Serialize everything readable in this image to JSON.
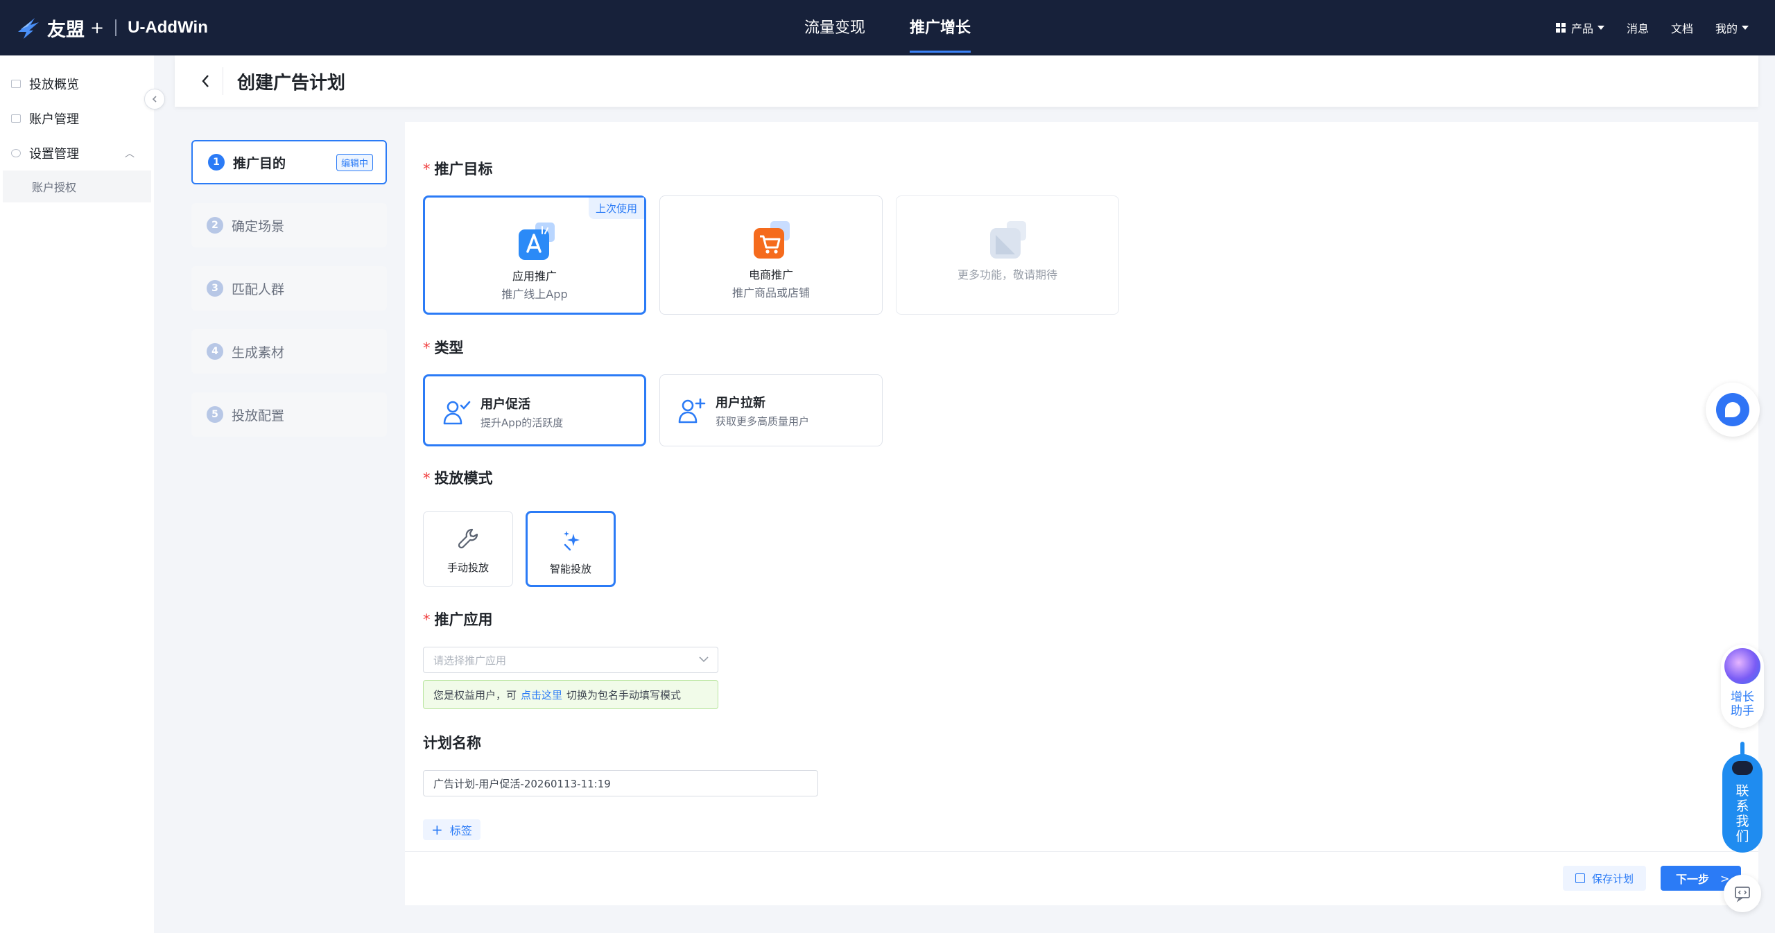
{
  "topbar": {
    "brand": "友盟",
    "brand_plus": "+",
    "product": "U-AddWin",
    "nav": [
      {
        "label": "流量变现",
        "active": false
      },
      {
        "label": "推广增长",
        "active": true
      }
    ],
    "right": {
      "products": "产品",
      "messages": "消息",
      "docs": "文档",
      "mine": "我的"
    }
  },
  "sidebar": {
    "items": [
      {
        "label": "投放概览"
      },
      {
        "label": "账户管理"
      },
      {
        "label": "设置管理",
        "expanded": true
      }
    ],
    "sub_items": [
      {
        "label": "账户授权"
      }
    ]
  },
  "header": {
    "title": "创建广告计划"
  },
  "steps": [
    {
      "num": "1",
      "label": "推广目的",
      "badge": "编辑中",
      "active": true
    },
    {
      "num": "2",
      "label": "确定场景",
      "active": false
    },
    {
      "num": "3",
      "label": "匹配人群",
      "active": false
    },
    {
      "num": "4",
      "label": "生成素材",
      "active": false
    },
    {
      "num": "5",
      "label": "投放配置",
      "active": false
    }
  ],
  "form": {
    "required_mark": "*",
    "target": {
      "label": "推广目标",
      "options": [
        {
          "title": "应用推广",
          "subtitle": "推广线上App",
          "badge": "上次使用",
          "selected": true,
          "icon": "app-store-icon"
        },
        {
          "title": "电商推广",
          "subtitle": "推广商品或店铺",
          "selected": false,
          "icon": "shopping-cart-icon"
        },
        {
          "note": "更多功能，敬请期待",
          "disabled": true,
          "icon": "coming-soon-icon"
        }
      ]
    },
    "type": {
      "label": "类型",
      "options": [
        {
          "title": "用户促活",
          "subtitle": "提升App的活跃度",
          "selected": true,
          "icon": "user-check-icon"
        },
        {
          "title": "用户拉新",
          "subtitle": "获取更多高质量用户",
          "selected": false,
          "icon": "user-add-icon"
        }
      ]
    },
    "mode": {
      "label": "投放模式",
      "options": [
        {
          "title": "手动投放",
          "selected": false,
          "icon": "wrench-icon"
        },
        {
          "title": "智能投放",
          "selected": true,
          "icon": "sparkle-icon"
        }
      ]
    },
    "app": {
      "label": "推广应用",
      "placeholder": "请选择推广应用",
      "tip_before": "您是权益用户，可",
      "tip_link": "点击这里",
      "tip_after": "切换为包名手动填写模式"
    },
    "plan_name": {
      "label": "计划名称",
      "value": "广告计划-用户促活-20260113-11:19"
    },
    "tag_button": "标签",
    "save_button": "保存计划",
    "next_button": "下一步"
  },
  "widgets": {
    "assistant_label_line1": "增长",
    "assistant_label_line2": "助手",
    "contact_chars": [
      "联",
      "系",
      "我",
      "们"
    ]
  },
  "colors": {
    "topbar_bg": "#17213a",
    "accent": "#2b7bf6",
    "required": "#f04040"
  }
}
